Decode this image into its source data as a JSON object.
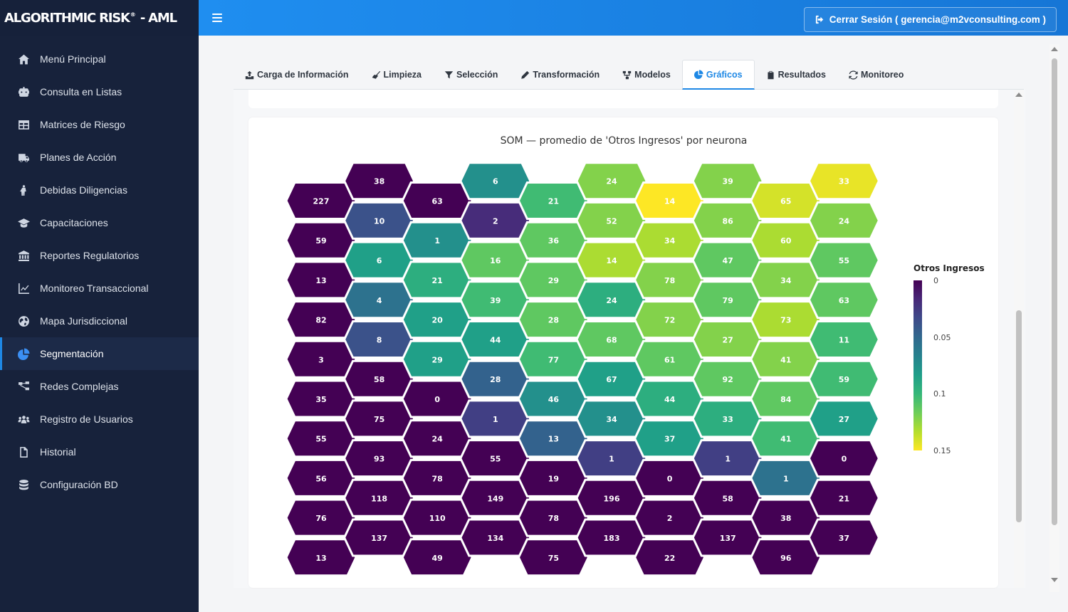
{
  "brand": {
    "name": "ALGORITHMIC RISK",
    "registered": "®",
    "suffix": "- AML"
  },
  "header": {
    "logout_label": "Cerrar Sesión ( gerencia@m2vconsulting.com )"
  },
  "sidebar": {
    "items": [
      {
        "label": "Menú Principal",
        "icon": "home-icon"
      },
      {
        "label": "Consulta en Listas",
        "icon": "robot-icon"
      },
      {
        "label": "Matrices de Riesgo",
        "icon": "table-icon"
      },
      {
        "label": "Planes de Acción",
        "icon": "truck-icon"
      },
      {
        "label": "Debidas Diligencias",
        "icon": "person-icon"
      },
      {
        "label": "Capacitaciones",
        "icon": "graduation-cap-icon"
      },
      {
        "label": "Reportes Regulatorios",
        "icon": "bank-icon"
      },
      {
        "label": "Monitoreo Transaccional",
        "icon": "line-chart-icon"
      },
      {
        "label": "Mapa Jurisdiccional",
        "icon": "globe-icon"
      },
      {
        "label": "Segmentación",
        "icon": "pie-chart-icon",
        "active": true
      },
      {
        "label": "Redes Complejas",
        "icon": "network-icon"
      },
      {
        "label": "Registro de Usuarios",
        "icon": "users-icon"
      },
      {
        "label": "Historial",
        "icon": "file-icon"
      },
      {
        "label": "Configuración BD",
        "icon": "database-icon"
      }
    ]
  },
  "tabs": [
    {
      "label": "Carga de Información",
      "icon": "upload-icon"
    },
    {
      "label": "Limpieza",
      "icon": "broom-icon"
    },
    {
      "label": "Selección",
      "icon": "filter-icon"
    },
    {
      "label": "Transformación",
      "icon": "pencil-icon"
    },
    {
      "label": "Modelos",
      "icon": "sitemap-icon"
    },
    {
      "label": "Gráficos",
      "icon": "pie-chart-icon",
      "active": true
    },
    {
      "label": "Resultados",
      "icon": "clipboard-check-icon"
    },
    {
      "label": "Monitoreo",
      "icon": "sync-icon"
    }
  ],
  "chart_data": {
    "type": "heatmap",
    "title": "SOM — promedio de 'Otros Ingresos' por neurona",
    "legend_title": "Otros Ingresos",
    "legend_ticks": [
      "0",
      "0.05",
      "0.1",
      "0.15"
    ],
    "colorscale": "viridis",
    "range": [
      0,
      0.16
    ],
    "columns": [
      {
        "labels": [
          227,
          59,
          13,
          82,
          3,
          35,
          55,
          56,
          76,
          13
        ],
        "values": [
          0,
          0,
          0,
          0,
          0,
          0,
          0,
          0,
          0,
          0
        ]
      },
      {
        "labels": [
          38,
          10,
          6,
          4,
          8,
          58,
          75,
          93,
          118,
          137
        ],
        "values": [
          0,
          0.04,
          0.09,
          0.06,
          0.04,
          0,
          0,
          0,
          0,
          0
        ]
      },
      {
        "labels": [
          63,
          1,
          21,
          20,
          29,
          0,
          24,
          78,
          110,
          49
        ],
        "values": [
          0,
          0.08,
          0.1,
          0.09,
          0.09,
          0,
          0,
          0,
          0,
          0
        ]
      },
      {
        "labels": [
          6,
          2,
          16,
          39,
          44,
          28,
          1,
          55,
          149,
          134
        ],
        "values": [
          0.08,
          0.02,
          0.12,
          0.11,
          0.09,
          0.05,
          0.03,
          0,
          0,
          0
        ]
      },
      {
        "labels": [
          21,
          36,
          29,
          28,
          77,
          46,
          13,
          19,
          78,
          75
        ],
        "values": [
          0.11,
          0.12,
          0.12,
          0.12,
          0.11,
          0.08,
          0.05,
          0,
          0,
          0
        ]
      },
      {
        "labels": [
          24,
          52,
          14,
          24,
          68,
          67,
          34,
          1,
          196,
          183
        ],
        "values": [
          0.13,
          0.13,
          0.14,
          0.1,
          0.12,
          0.09,
          0.08,
          0.03,
          0,
          0
        ]
      },
      {
        "labels": [
          14,
          34,
          78,
          72,
          61,
          44,
          37,
          0,
          2,
          22
        ],
        "values": [
          0.16,
          0.14,
          0.13,
          0.13,
          0.12,
          0.1,
          0.09,
          0,
          0,
          0
        ]
      },
      {
        "labels": [
          39,
          86,
          47,
          79,
          27,
          92,
          33,
          1,
          58,
          137
        ],
        "values": [
          0.13,
          0.13,
          0.12,
          0.12,
          0.13,
          0.12,
          0.1,
          0.03,
          0,
          0
        ]
      },
      {
        "labels": [
          65,
          60,
          34,
          73,
          41,
          84,
          41,
          1,
          38,
          96
        ],
        "values": [
          0.15,
          0.14,
          0.13,
          0.14,
          0.13,
          0.12,
          0.11,
          0.06,
          0,
          0
        ]
      },
      {
        "labels": [
          33,
          24,
          55,
          63,
          11,
          59,
          27,
          0,
          21,
          37
        ],
        "values": [
          0.155,
          0.13,
          0.12,
          0.12,
          0.11,
          0.11,
          0.09,
          0,
          0,
          0
        ]
      }
    ]
  }
}
